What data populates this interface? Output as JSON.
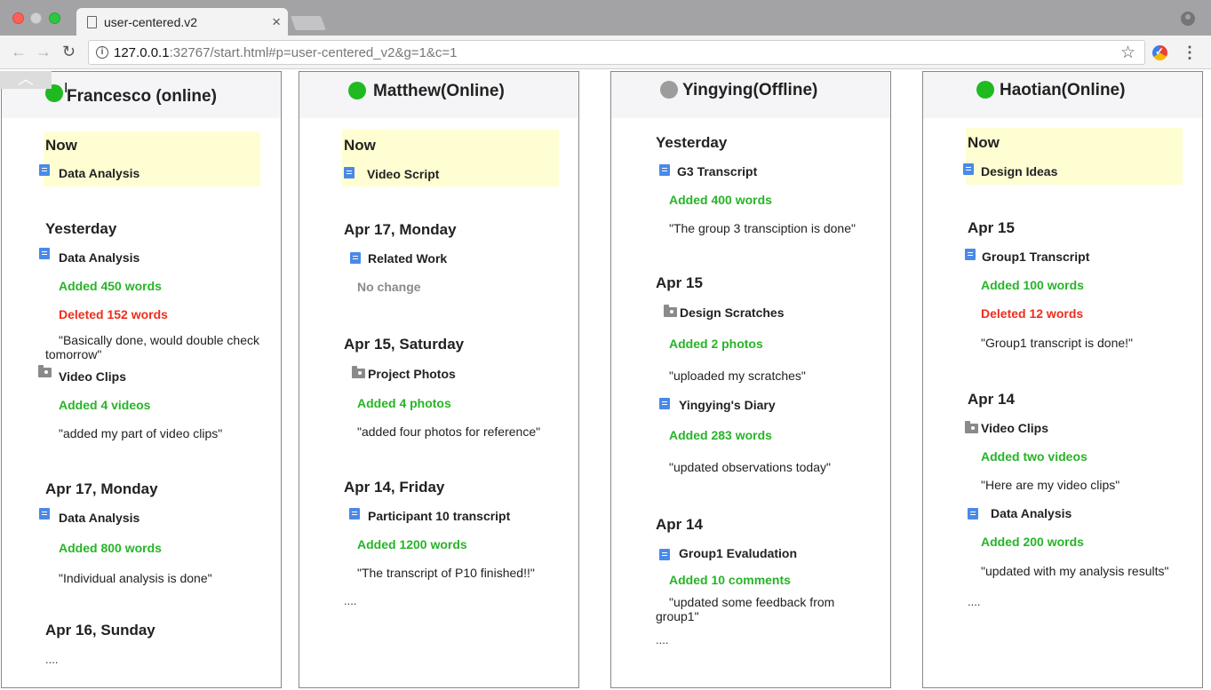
{
  "browser": {
    "tab_title": "user-centered.v2",
    "tab_close": "×",
    "url_host": "127.0.0.1",
    "url_path": ":32767/start.html#p=user-centered_v2&g=1&c=1",
    "back": "←",
    "forward": "→",
    "reload": "↻",
    "star": "☆",
    "menu": "⋮",
    "info": "i"
  },
  "collapse_label": "︿",
  "columns": [
    {
      "name": "Francesco (online)",
      "status": "online",
      "now_label": "Now",
      "now_doc": "Data Analysis",
      "sections": [
        {
          "day": "Yesterday",
          "items": [
            {
              "doc": "Data Analysis",
              "type": "doc",
              "changes": [
                "Added 450 words",
                "Deleted 152 words"
              ],
              "note": "\"Basically done, would double check tomorrow\""
            },
            {
              "doc": "Video Clips",
              "type": "folder",
              "changes": [
                "Added 4 videos"
              ],
              "note": "\"added my part of video clips\""
            }
          ]
        },
        {
          "day": "Apr 17, Monday",
          "items": [
            {
              "doc": "Data Analysis",
              "type": "doc",
              "changes": [
                "Added 800 words"
              ],
              "note": "\"Individual analysis is done\""
            }
          ]
        },
        {
          "day": "Apr 16, Sunday",
          "more": "...."
        }
      ]
    },
    {
      "name": "Matthew(Online)",
      "status": "online",
      "now_label": "Now",
      "now_doc": "Video Script",
      "sections": [
        {
          "day": "Apr 17, Monday",
          "items": [
            {
              "doc": "Related Work",
              "type": "doc",
              "changes": [
                "No change"
              ],
              "note": ""
            }
          ]
        },
        {
          "day": "Apr 15, Saturday",
          "items": [
            {
              "doc": "Project Photos",
              "type": "folder",
              "changes": [
                "Added 4 photos"
              ],
              "note": "\"added four photos for reference\""
            }
          ]
        },
        {
          "day": "Apr 14, Friday",
          "items": [
            {
              "doc": "Participant 10 transcript",
              "type": "doc",
              "changes": [
                "Added 1200 words"
              ],
              "note": "\"The transcript of P10 finished!!\""
            }
          ],
          "more": "...."
        }
      ]
    },
    {
      "name": "Yingying(Offline)",
      "status": "offline",
      "sections": [
        {
          "day": "Yesterday",
          "items": [
            {
              "doc": "G3 Transcript",
              "type": "doc",
              "changes": [
                "Added 400 words"
              ],
              "note": "\"The group 3 transciption is done\""
            }
          ]
        },
        {
          "day": "Apr 15",
          "items": [
            {
              "doc": "Design Scratches",
              "type": "folder",
              "changes": [
                "Added 2 photos"
              ],
              "note": "\"uploaded my scratches\""
            },
            {
              "doc": "Yingying's Diary",
              "type": "doc",
              "changes": [
                "Added 283 words"
              ],
              "note": "\"updated observations today\""
            }
          ]
        },
        {
          "day": "Apr 14",
          "items": [
            {
              "doc": "Group1 Evaludation",
              "type": "doc",
              "changes": [
                "Added 10 comments"
              ],
              "note": "\"updated some feedback from group1\""
            }
          ],
          "more": "...."
        }
      ]
    },
    {
      "name": "Haotian(Online)",
      "status": "online",
      "now_label": "Now",
      "now_doc": "Design Ideas",
      "sections": [
        {
          "day": "Apr 15",
          "items": [
            {
              "doc": "Group1 Transcript",
              "type": "doc",
              "changes": [
                "Added 100 words",
                "Deleted 12 words"
              ],
              "note": "\"Group1 transcript is done!\""
            }
          ]
        },
        {
          "day": "Apr 14",
          "items": [
            {
              "doc": "Video Clips",
              "type": "folder",
              "changes": [
                "Added two videos"
              ],
              "note": "\"Here are my video clips\""
            },
            {
              "doc": "Data Analysis",
              "type": "doc",
              "changes": [
                "Added 200 words"
              ],
              "note": "\"updated with my analysis results\""
            }
          ],
          "more": "...."
        }
      ]
    }
  ]
}
